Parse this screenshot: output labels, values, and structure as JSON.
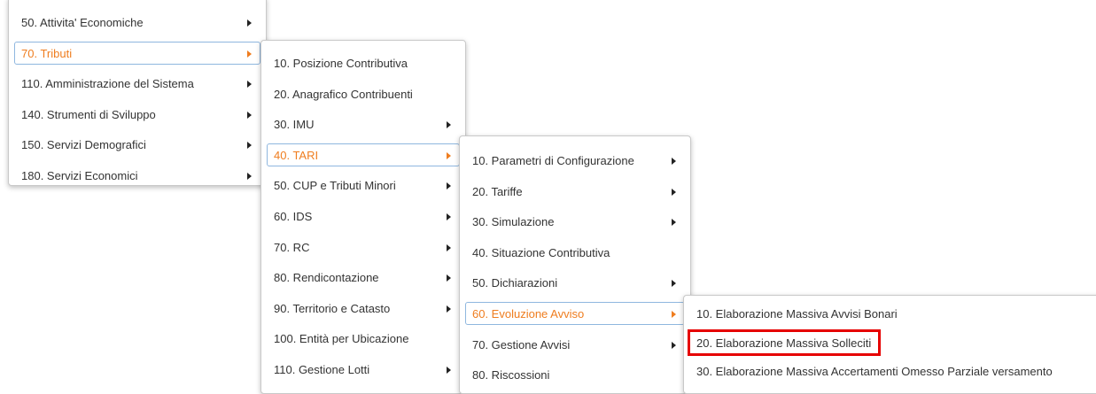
{
  "accent_color": "#ef7d1f",
  "highlight_color": "#e60000",
  "menus": [
    {
      "items": [
        {
          "label": "50. Attivita' Economiche",
          "submenu": true
        },
        {
          "label": "70. Tributi",
          "submenu": true,
          "active": true
        },
        {
          "label": "110. Amministrazione del Sistema",
          "submenu": true
        },
        {
          "label": "140. Strumenti di Sviluppo",
          "submenu": true
        },
        {
          "label": "150. Servizi Demografici",
          "submenu": true
        },
        {
          "label": "180. Servizi Economici",
          "submenu": true
        }
      ]
    },
    {
      "items": [
        {
          "label": "10. Posizione Contributiva",
          "submenu": false
        },
        {
          "label": "20. Anagrafico Contribuenti",
          "submenu": false
        },
        {
          "label": "30. IMU",
          "submenu": true
        },
        {
          "label": "40. TARI",
          "submenu": true,
          "active": true
        },
        {
          "label": "50. CUP e Tributi Minori",
          "submenu": true
        },
        {
          "label": "60. IDS",
          "submenu": true
        },
        {
          "label": "70. RC",
          "submenu": true
        },
        {
          "label": "80. Rendicontazione",
          "submenu": true
        },
        {
          "label": "90. Territorio e Catasto",
          "submenu": true
        },
        {
          "label": "100. Entità per Ubicazione",
          "submenu": false
        },
        {
          "label": "110. Gestione Lotti",
          "submenu": true
        }
      ]
    },
    {
      "items": [
        {
          "label": "10. Parametri di Configurazione",
          "submenu": true
        },
        {
          "label": "20. Tariffe",
          "submenu": true
        },
        {
          "label": "30. Simulazione",
          "submenu": true
        },
        {
          "label": "40. Situazione Contributiva",
          "submenu": false
        },
        {
          "label": "50. Dichiarazioni",
          "submenu": true
        },
        {
          "label": "60. Evoluzione Avviso",
          "submenu": true,
          "active": true
        },
        {
          "label": "70. Gestione Avvisi",
          "submenu": true
        },
        {
          "label": "80. Riscossioni",
          "submenu": false
        }
      ]
    },
    {
      "items": [
        {
          "label": "10. Elaborazione Massiva Avvisi Bonari",
          "submenu": false
        },
        {
          "label": "20. Elaborazione Massiva Solleciti",
          "submenu": false,
          "highlighted": true
        },
        {
          "label": "30. Elaborazione Massiva Accertamenti Omesso Parziale versamento",
          "submenu": false
        }
      ]
    }
  ]
}
